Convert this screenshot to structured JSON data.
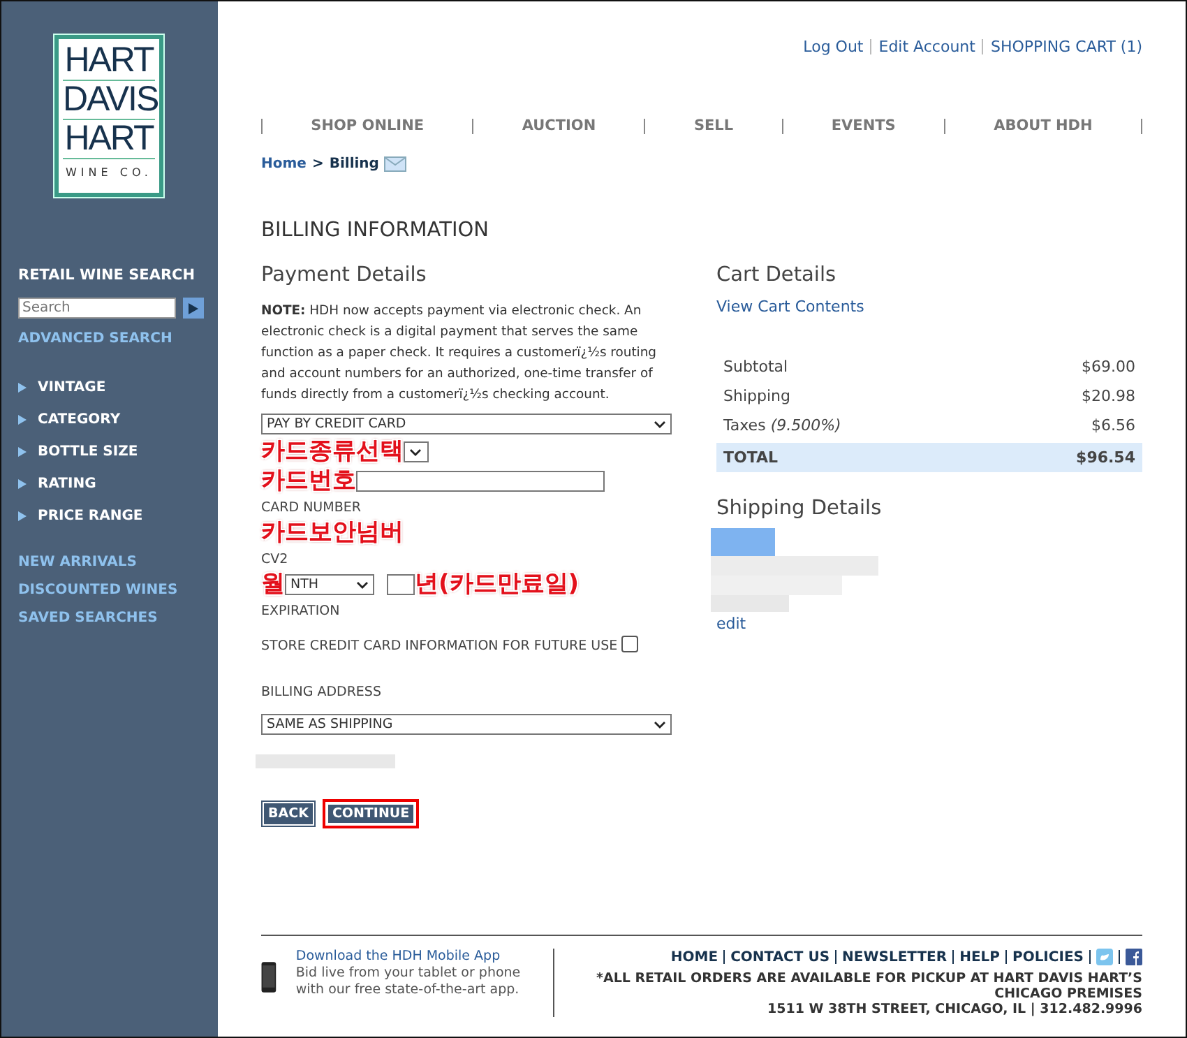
{
  "logo": {
    "lines": [
      "HART",
      "DAVIS",
      "HART"
    ],
    "tagline": "WINE CO."
  },
  "sidebar": {
    "search_title": "RETAIL WINE SEARCH",
    "search": {
      "placeholder": "Search"
    },
    "advanced_link": "ADVANCED SEARCH",
    "filters": [
      "VINTAGE",
      "CATEGORY",
      "BOTTLE SIZE",
      "RATING",
      "PRICE RANGE"
    ],
    "links": [
      "NEW ARRIVALS",
      "DISCOUNTED WINES",
      "SAVED SEARCHES"
    ]
  },
  "account_links": [
    "Log Out",
    "Edit Account",
    "SHOPPING CART (1)"
  ],
  "nav": [
    "SHOP ONLINE",
    "AUCTION",
    "SELL",
    "EVENTS",
    "ABOUT HDH"
  ],
  "breadcrumb": [
    "Home",
    ">",
    "Billing"
  ],
  "page_title": "BILLING INFORMATION",
  "payment": {
    "title": "Payment Details",
    "note": "**NOTE:** HDH now accepts payment via electronic check. An electronic check is a digital payment that serves the same function as a paper check. It requires a customerï¿½s routing and account numbers for an authorized, one-time transfer of funds directly from a customerï¿½s checking account.",
    "method": "PAY BY CREDIT CARD",
    "card_type_annotation": "카드종류선택",
    "card_number_annotation": "카드번호",
    "card_number_label": "CARD NUMBER",
    "cv2_annotation": "카드보안넘버",
    "cv2_label": "CV2",
    "month_annotation": "월",
    "month_value": "NTH",
    "year_annotation": "년(카드만료일)",
    "expiration_label": "EXPIRATION",
    "store_label": "STORE CREDIT CARD INFORMATION FOR FUTURE USE",
    "store_checked": false,
    "billing_address_label": "BILLING ADDRESS",
    "billing_address": "SAME AS SHIPPING",
    "buttons": [
      {
        "label": "BACK",
        "highlighted": false
      },
      {
        "label": "CONTINUE",
        "highlighted": true
      }
    ]
  },
  "cart": {
    "title": "Cart Details",
    "view_link": "View Cart Contents",
    "rows": [
      {
        "label": "Subtotal",
        "amount": "$69.00"
      },
      {
        "label": "Shipping",
        "amount": "$20.98"
      },
      {
        "label": "Taxes",
        "note": "(9.500%)",
        "amount": "$6.56"
      }
    ],
    "total": {
      "label": "TOTAL",
      "amount": "$96.54"
    }
  },
  "shipping": {
    "title": "Shipping Details",
    "edit_link": "edit"
  },
  "footer": {
    "app_title": "Download the HDH Mobile App",
    "app_text": "Bid live from your tablet or phone with our free state-of-the-art app.",
    "links": [
      "HOME",
      "CONTACT US",
      "NEWSLETTER",
      "HELP",
      "POLICIES"
    ],
    "notice": "*ALL RETAIL ORDERS ARE AVAILABLE FOR PICKUP AT HART DAVIS HART’S CHICAGO PREMISES",
    "address": "1511 W 38TH STREET, CHICAGO, IL | 312.482.9996"
  }
}
